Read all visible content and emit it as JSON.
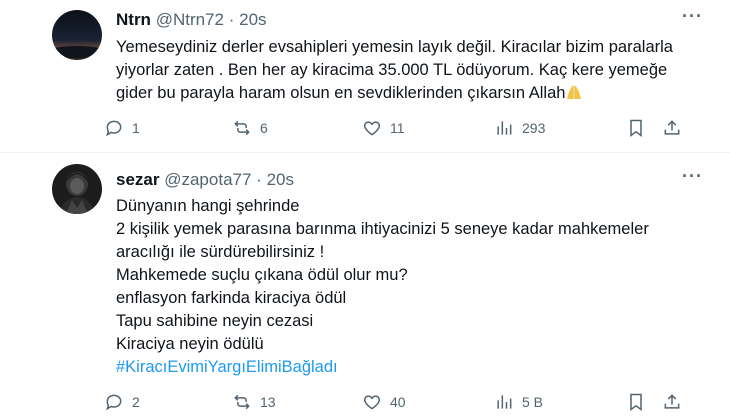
{
  "tweets": [
    {
      "name": "Ntrn",
      "handle": "@Ntrn72",
      "time": "20s",
      "separator": "·",
      "lines": [
        "Yemeseydiniz derler evsahipleri yemesin layık değil. Kiracılar bizim paralarla",
        "yiyorlar zaten . Ben her ay kiracima 35.000 TL ödüyorum.  Kaç kere yemeğe",
        "gider bu parayla haram olsun en sevdiklerinden çıkarsın Allah"
      ],
      "emoji": "praying-hands",
      "stats": {
        "replies": "1",
        "retweets": "6",
        "likes": "11",
        "views": "293"
      }
    },
    {
      "name": "sezar",
      "handle": "@zapota77",
      "time": "20s",
      "separator": "·",
      "lines": [
        "Dünyanın hangi şehrinde",
        "2 kişilik yemek parasına barınma ihtiyacinizi 5 seneye kadar mahkemeler",
        "aracılığı ile sürdürebilirsiniz !",
        "Mahkemede suçlu çıkana ödül olur mu?",
        "enflasyon farkinda kiraciya ödül",
        "Tapu sahibine neyin cezasi",
        "Kiraciya neyin ödülü"
      ],
      "hashtag": "#KiracıEvimiYargıElimiBağladı",
      "stats": {
        "replies": "2",
        "retweets": "13",
        "likes": "40",
        "views": "5 B"
      }
    }
  ],
  "icons": {
    "reply": "reply-icon",
    "retweet": "retweet-icon",
    "like": "heart-icon",
    "views": "views-chart-icon",
    "bookmark": "bookmark-icon",
    "share": "share-icon",
    "more": "more-dots-icon"
  },
  "colors": {
    "link": "#1d9bf0",
    "muted": "#536471",
    "text": "#0f1419"
  }
}
